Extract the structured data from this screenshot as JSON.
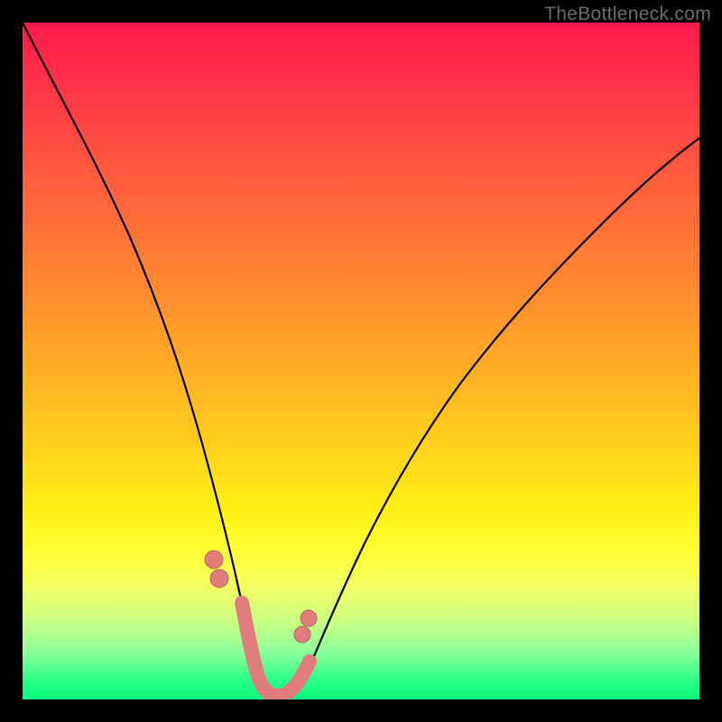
{
  "watermark": "TheBottleneck.com",
  "chart_data": {
    "type": "line",
    "title": "",
    "xlabel": "",
    "ylabel": "",
    "xlim": [
      0,
      100
    ],
    "ylim": [
      0,
      100
    ],
    "grid": false,
    "legend": false,
    "series": [
      {
        "name": "bottleneck-curve",
        "color": "#000000",
        "x": [
          0,
          5,
          10,
          15,
          20,
          25,
          28,
          30,
          32,
          34,
          35,
          36,
          37,
          38,
          40,
          42,
          45,
          50,
          55,
          60,
          70,
          80,
          90,
          100
        ],
        "y": [
          100,
          90,
          79,
          66,
          52,
          36,
          25,
          17,
          10,
          5,
          3,
          2,
          2,
          3,
          5,
          9,
          15,
          25,
          34,
          42,
          55,
          66,
          75,
          82
        ]
      }
    ],
    "markers": {
      "name": "highlight-beads",
      "color": "#e07c7c",
      "x": [
        28.5,
        29.5,
        33,
        34,
        35,
        36,
        37,
        38,
        39,
        40,
        41.5,
        42.5
      ],
      "y": [
        20,
        17,
        5,
        3,
        2,
        2,
        2,
        2,
        3,
        5,
        10,
        13
      ]
    }
  }
}
